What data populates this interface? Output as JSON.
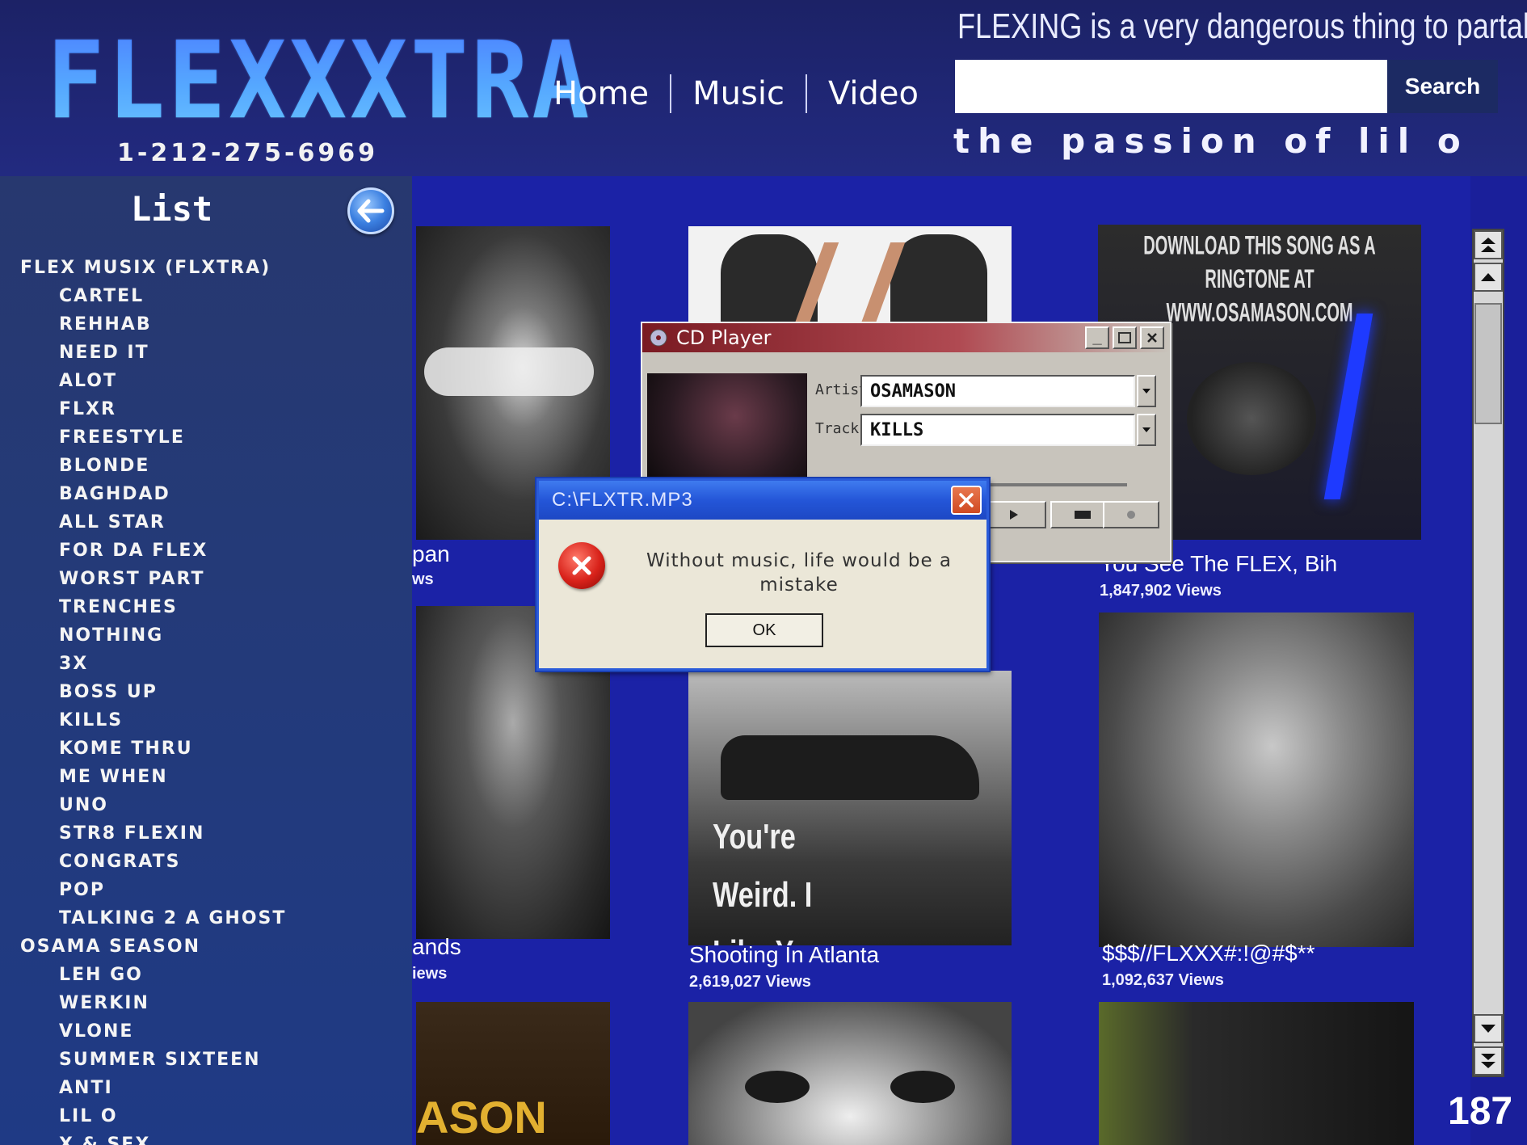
{
  "header": {
    "logo": "FLEXXXTRA",
    "phone": "1-212-275-6969",
    "nav": [
      "Home",
      "Music",
      "Video"
    ],
    "tagline_top": "FLEXING is a very dangerous thing to partake in",
    "search": {
      "placeholder": "",
      "value": "",
      "button_label": "Search"
    },
    "tagline_bottom": "the passion of lil o"
  },
  "sidebar": {
    "title": "List",
    "items": [
      {
        "label": "FLEX MUSIX (FLXTRA)",
        "level": 0
      },
      {
        "label": "CARTEL",
        "level": 1
      },
      {
        "label": "REHHAB",
        "level": 1
      },
      {
        "label": "NEED IT",
        "level": 1
      },
      {
        "label": "ALOT",
        "level": 1
      },
      {
        "label": "FLXR",
        "level": 1
      },
      {
        "label": "FREESTYLE",
        "level": 1
      },
      {
        "label": "BLONDE",
        "level": 1
      },
      {
        "label": "BAGHDAD",
        "level": 1
      },
      {
        "label": "ALL STAR",
        "level": 1
      },
      {
        "label": "FOR DA FLEX",
        "level": 1
      },
      {
        "label": "WORST PART",
        "level": 1
      },
      {
        "label": "TRENCHES",
        "level": 1
      },
      {
        "label": "NOTHING",
        "level": 1
      },
      {
        "label": "3X",
        "level": 1
      },
      {
        "label": "BOSS UP",
        "level": 1
      },
      {
        "label": "KILLS",
        "level": 1
      },
      {
        "label": "KOME  THRU",
        "level": 1
      },
      {
        "label": "ME WHEN",
        "level": 1
      },
      {
        "label": "UNO",
        "level": 1
      },
      {
        "label": "STR8 FLEXIN",
        "level": 1
      },
      {
        "label": "CONGRATS",
        "level": 1
      },
      {
        "label": "POP",
        "level": 1
      },
      {
        "label": "TALKING 2 A GHOST",
        "level": 1
      },
      {
        "label": "OSAMA SEASON",
        "level": 0
      },
      {
        "label": "LEH GO",
        "level": 1
      },
      {
        "label": "WERKIN",
        "level": 1
      },
      {
        "label": "VLONE",
        "level": 1
      },
      {
        "label": "SUMMER SIXTEEN",
        "level": 1
      },
      {
        "label": "ANTI",
        "level": 1
      },
      {
        "label": "LIL O",
        "level": 1
      },
      {
        "label": "X & SEX",
        "level": 1
      }
    ]
  },
  "grid": {
    "cards": [
      {
        "title": "pan",
        "views": "ws"
      },
      {
        "title": "",
        "views": ""
      },
      {
        "title": "You See The FLEX, Bih",
        "views": "1,847,902 Views",
        "overlay": "DOWNLOAD THIS SONG AS A RINGTONE AT WWW.OSAMASON.COM"
      },
      {
        "title": "ands",
        "views": "iews"
      },
      {
        "title": "Shooting In Atlanta",
        "views": "2,619,027 Views",
        "overlay": "You're Weird. I Like You."
      },
      {
        "title": "$$$//FLXXX#:!@#$**",
        "views": "1,092,637 Views"
      },
      {
        "title": "",
        "views": "",
        "overlay": "ASON"
      },
      {
        "title": "",
        "views": ""
      },
      {
        "title": "",
        "views": ""
      }
    ]
  },
  "page_number": "187",
  "cd_player": {
    "title": "CD Player",
    "artist_label": "Artist:",
    "artist": "OSAMASON",
    "track_label": "Track:",
    "track": "KILLS"
  },
  "dialog": {
    "title": "C:\\FLXTR.MP3",
    "message": "Without music, life would be a mistake",
    "ok_label": "OK"
  },
  "colors": {
    "page_bg": "#1b22a6",
    "header_bg": "#1c2266",
    "sidebar_bg": "#243a78",
    "logo": "#3fa0ff",
    "dialog_title": "#2456d8",
    "cd_title": "#7a1a22"
  }
}
